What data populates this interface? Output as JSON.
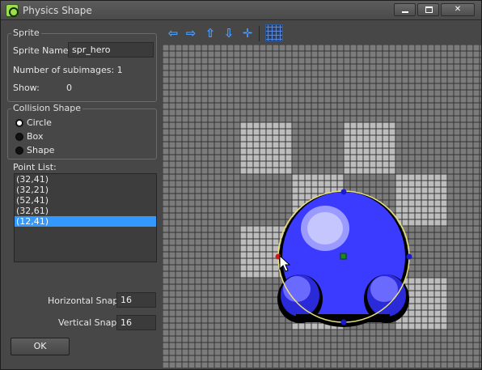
{
  "window": {
    "title": "Physics Shape"
  },
  "sprite_group": {
    "legend": "Sprite",
    "name_label": "Sprite Name:",
    "name_value": "spr_hero",
    "subimages_label": "Number of subimages: 1",
    "show_label": "Show:",
    "show_value": "0"
  },
  "collision_group": {
    "legend": "Collision Shape",
    "options": [
      "Circle",
      "Box",
      "Shape"
    ],
    "selected": "Circle"
  },
  "point_list": {
    "label": "Point List:",
    "items": [
      "(32,41)",
      "(32,21)",
      "(52,41)",
      "(32,61)",
      "(12,41)"
    ],
    "selected_index": 4
  },
  "snap": {
    "horizontal_label": "Horizontal Snap:",
    "horizontal_value": "16",
    "vertical_label": "Vertical Snap:",
    "vertical_value": "16"
  },
  "ok_label": "OK",
  "toolbar": {
    "icons": [
      "arrow-left-icon",
      "arrow-right-icon",
      "arrow-up-icon",
      "arrow-down-icon",
      "center-cross-icon",
      "grid-toggle-icon"
    ]
  },
  "colors": {
    "selection": "#3399ff",
    "toolbar_icon": "#4aa0ff",
    "sprite_body": "#3b3bff",
    "collision_circle": "#e8e07a",
    "point_handle": "#1a1ad0",
    "selected_point": "#d01a1a",
    "center_point": "#1e8a1e"
  }
}
